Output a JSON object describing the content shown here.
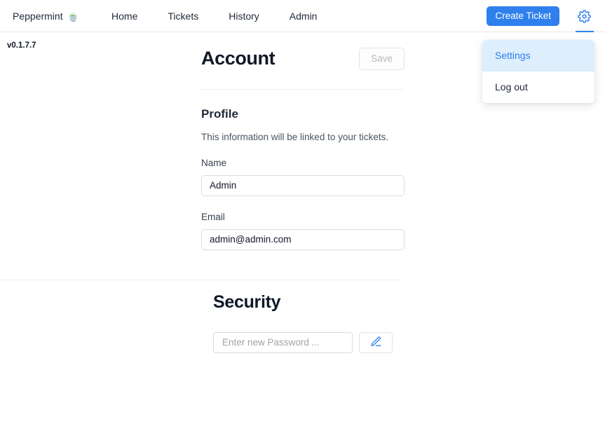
{
  "navbar": {
    "brand": {
      "label": "Peppermint",
      "emoji": "🍵",
      "icon_name": "bowl-emoji"
    },
    "links": [
      {
        "label": "Home",
        "name": "nav-link-home"
      },
      {
        "label": "Tickets",
        "name": "nav-link-tickets"
      },
      {
        "label": "History",
        "name": "nav-link-history"
      },
      {
        "label": "Admin",
        "name": "nav-link-admin"
      }
    ],
    "create_ticket_label": "Create Ticket",
    "gear_icon": "gear-icon",
    "accent_color": "#2f80ed"
  },
  "dropdown": {
    "items": [
      {
        "label": "Settings",
        "active": true
      },
      {
        "label": "Log out",
        "active": false
      }
    ],
    "active_bg": "#ddeefc",
    "active_text": "#2f80ed"
  },
  "version": "v0.1.7.7",
  "account": {
    "title": "Account",
    "save_label": "Save",
    "profile_title": "Profile",
    "profile_subtitle": "This information will be linked to your tickets.",
    "name_label": "Name",
    "name_value": "Admin",
    "name_placeholder": "",
    "email_label": "Email",
    "email_value": "admin@admin.com",
    "email_placeholder": ""
  },
  "security": {
    "title": "Security",
    "password_placeholder": "Enter new Password ...",
    "password_value": "",
    "edit_icon": "pencil-icon"
  }
}
